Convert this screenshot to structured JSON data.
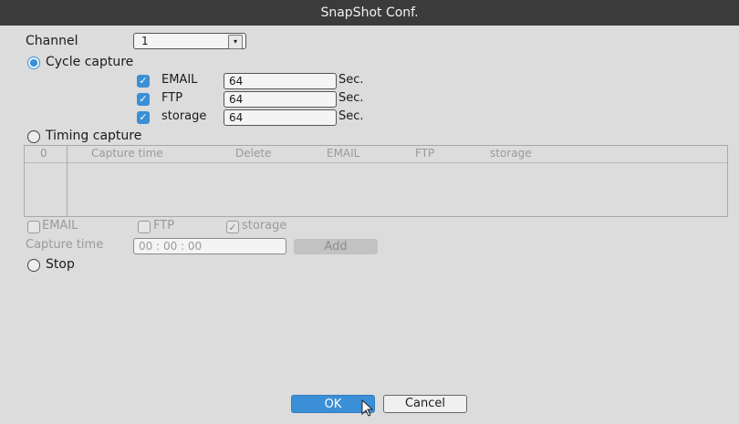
{
  "window": {
    "title": "SnapShot Conf."
  },
  "channel": {
    "label": "Channel",
    "value": "1",
    "arrow": "▾"
  },
  "cycle": {
    "label": "Cycle capture",
    "selected": true,
    "rows": [
      {
        "label": "EMAIL",
        "checked": true,
        "value": "64",
        "unit": "Sec."
      },
      {
        "label": "FTP",
        "checked": true,
        "value": "64",
        "unit": "Sec."
      },
      {
        "label": "storage",
        "checked": true,
        "value": "64",
        "unit": "Sec."
      }
    ]
  },
  "timing": {
    "label": "Timing capture",
    "selected": false,
    "table_headers": [
      "0",
      "Capture time",
      "Delete",
      "EMAIL",
      "FTP",
      "storage"
    ],
    "options": [
      {
        "label": "EMAIL",
        "checked": false
      },
      {
        "label": "FTP",
        "checked": false
      },
      {
        "label": "storage",
        "checked": true
      }
    ],
    "capture_time_label": "Capture time",
    "capture_time_value": "00 : 00 : 00",
    "add_label": "Add"
  },
  "stop": {
    "label": "Stop",
    "selected": false
  },
  "buttons": {
    "ok": "OK",
    "cancel": "Cancel"
  },
  "colors": {
    "accent": "#3a8fd6",
    "titlebar": "#3b3b3b",
    "background": "#dcdcdc"
  }
}
